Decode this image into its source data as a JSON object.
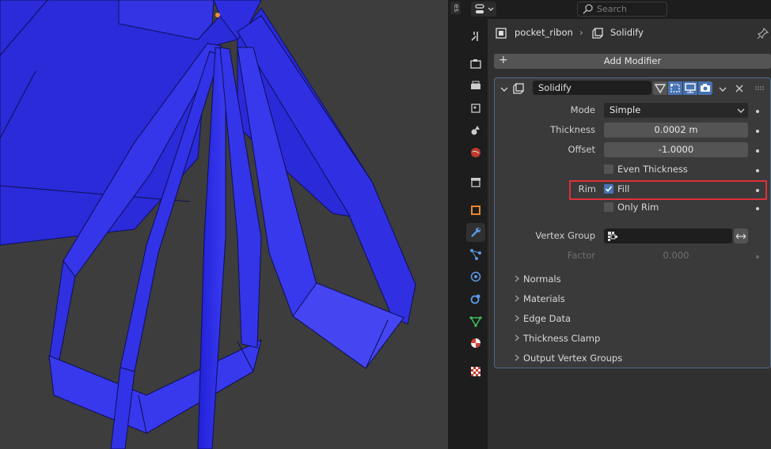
{
  "header": {
    "search_placeholder": "Search",
    "editor_type_icon": "properties-editor-icon"
  },
  "viewport": {
    "tab_text": "es",
    "mesh_color": "#3131e6",
    "background_color": "#3d3d3d"
  },
  "tabs": [
    {
      "name": "tool",
      "icon": "wrench-screwdriver-icon"
    },
    {
      "name": "render",
      "icon": "camera-back-icon"
    },
    {
      "name": "output",
      "icon": "printer-icon"
    },
    {
      "name": "view-layer",
      "icon": "image-stack-icon"
    },
    {
      "name": "scene",
      "icon": "scene-icon"
    },
    {
      "name": "world",
      "icon": "world-icon"
    },
    {
      "name": "collection",
      "icon": "collection-box-icon"
    },
    {
      "name": "object",
      "icon": "object-square-icon"
    },
    {
      "name": "modifiers",
      "icon": "wrench-icon",
      "active": true
    },
    {
      "name": "particles",
      "icon": "particles-icon"
    },
    {
      "name": "physics",
      "icon": "physics-icon"
    },
    {
      "name": "constraints",
      "icon": "constraints-icon"
    },
    {
      "name": "data",
      "icon": "mesh-data-icon"
    },
    {
      "name": "material",
      "icon": "material-icon"
    },
    {
      "name": "texture",
      "icon": "texture-checker-icon"
    }
  ],
  "breadcrumb": {
    "object_name": "pocket_ribon",
    "separator": "›",
    "modifier_name": "Solidify"
  },
  "add_modifier": {
    "plus": "+",
    "label": "Add Modifier"
  },
  "modifier": {
    "name": "Solidify",
    "mode_label": "Mode",
    "mode_value": "Simple",
    "thickness_label": "Thickness",
    "thickness_value": "0.0002 m",
    "offset_label": "Offset",
    "offset_value": "-1.0000",
    "even_thickness_label": "Even Thickness",
    "even_thickness_checked": false,
    "rim_label": "Rim",
    "fill_label": "Fill",
    "fill_checked": true,
    "only_rim_label": "Only Rim",
    "only_rim_checked": false,
    "vertex_group_label": "Vertex Group",
    "vertex_group_value": "",
    "factor_label": "Factor",
    "factor_value": "0.000",
    "highlight_color": "#e0303a",
    "subpanels": [
      "Normals",
      "Materials",
      "Edge Data",
      "Thickness Clamp",
      "Output Vertex Groups"
    ]
  }
}
